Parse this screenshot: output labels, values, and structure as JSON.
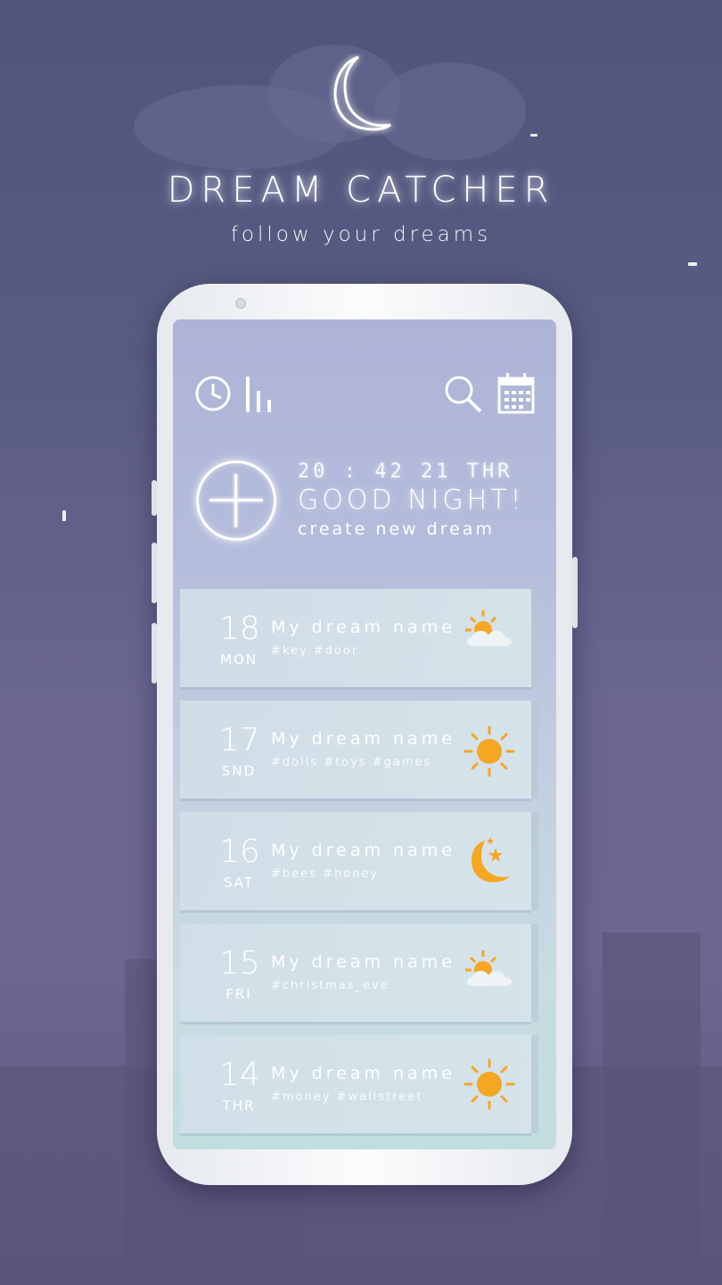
{
  "brand": {
    "title": "DREAM CATCHER",
    "tagline": "follow your dreams"
  },
  "header": {
    "time": "20 : 42  21 THR",
    "greeting": "GOOD NIGHT!",
    "create_label": "create new dream"
  },
  "toolbar": {
    "icons": [
      "clock-icon",
      "stats-icon",
      "search-icon",
      "calendar-icon"
    ]
  },
  "dreams": [
    {
      "day": "18",
      "weekday": "MON",
      "name": "My dream name",
      "tags": "#key #door",
      "weather": "partly-cloudy-icon"
    },
    {
      "day": "17",
      "weekday": "SND",
      "name": "My dream name",
      "tags": "#dolls #toys #games",
      "weather": "sun-icon"
    },
    {
      "day": "16",
      "weekday": "SAT",
      "name": "My dream name",
      "tags": "#bees #honey",
      "weather": "moon-stars-icon"
    },
    {
      "day": "15",
      "weekday": "FRI",
      "name": "My dream name",
      "tags": "#christmas_eve",
      "weather": "partly-cloudy-icon"
    },
    {
      "day": "14",
      "weekday": "THR",
      "name": "My dream name",
      "tags": "#money #wallstreet",
      "weather": "sun-icon"
    }
  ],
  "colors": {
    "background": "#5a5c83",
    "screen_top": "#adb3d6",
    "screen_bottom": "#c2dddf",
    "sun": "#f5a623",
    "card": "#d2dfe8"
  }
}
